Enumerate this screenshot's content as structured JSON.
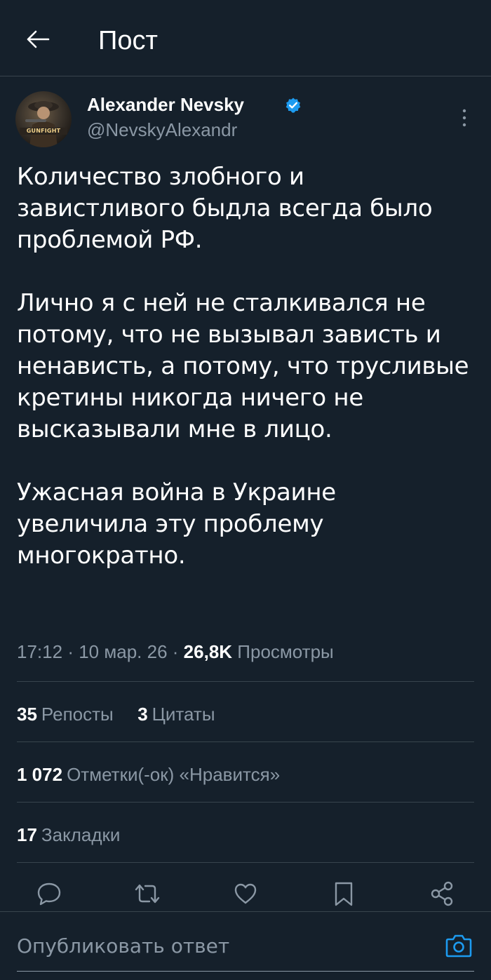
{
  "header": {
    "title": "Пост",
    "back_icon": "arrow-left-icon"
  },
  "author": {
    "name": "Alexander Nevsky",
    "handle": "@NevskyAlexandr",
    "verified": true,
    "avatar_logo_text": "GUNFIGHT"
  },
  "tweet": {
    "paragraphs": [
      "Количество злобного и завистливого быдла всегда было проблемой РФ.",
      "Лично я с ней не сталкивался не потому, что не вызывал зависть и ненависть, а потому, что трусливые кретины никогда ничего не высказывали мне в лицо.",
      "Ужасная война в Украине увеличила эту проблему многократно."
    ],
    "time": "17:12",
    "date": "10 мар. 26",
    "views_count": "26,8K",
    "views_label": "Просмотры",
    "dot": "·"
  },
  "stats": {
    "reposts_count": "35",
    "reposts_label": "Репосты",
    "quotes_count": "3",
    "quotes_label": "Цитаты",
    "likes_count": "1 072",
    "likes_label": "Отметки(-ок) «Нравится»",
    "bookmarks_count": "17",
    "bookmarks_label": "Закладки"
  },
  "actions": [
    "reply-icon",
    "repost-icon",
    "like-icon",
    "bookmark-icon",
    "share-icon"
  ],
  "reply_box": {
    "placeholder": "Опубликовать ответ",
    "camera_icon": "camera-icon"
  },
  "colors": {
    "background": "#15202b",
    "text": "#ffffff",
    "secondary_text": "#8b98a5",
    "separator": "#38444d",
    "accent": "#1d9bf0"
  }
}
